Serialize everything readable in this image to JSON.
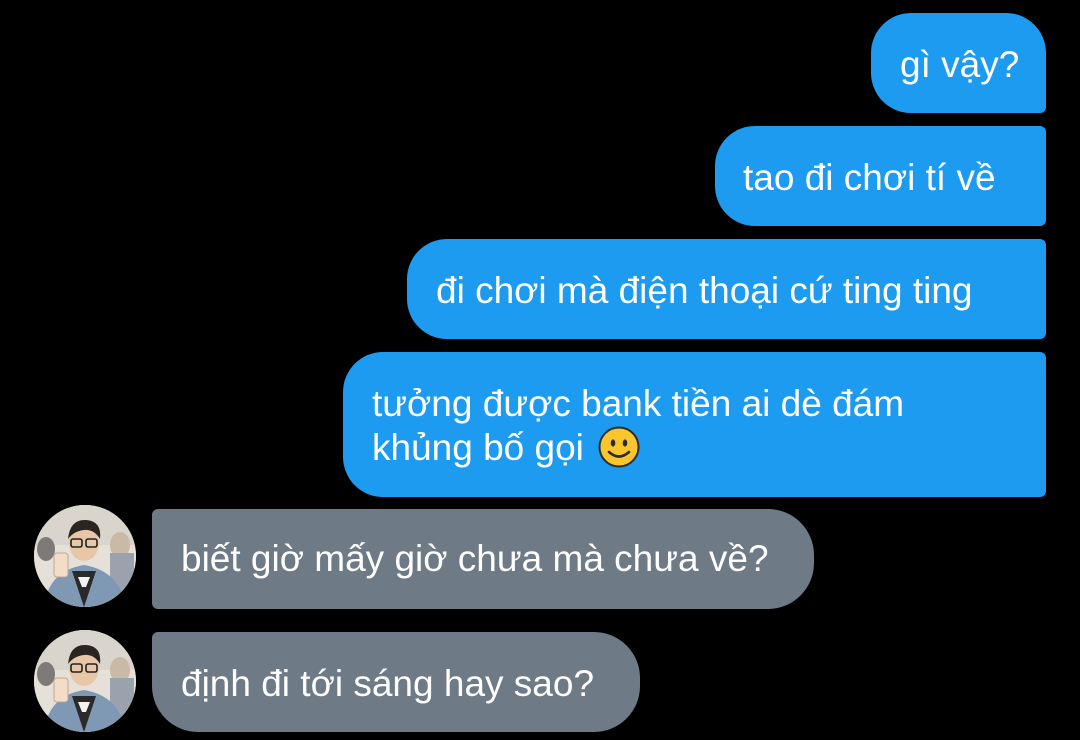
{
  "conversation": {
    "outgoing": [
      {
        "text": "gì vậy?"
      },
      {
        "text": "tao đi chơi tí về"
      },
      {
        "text": "đi chơi mà điện thoại cứ ting ting"
      },
      {
        "line1": "tưởng được bank tiền ai dè đám",
        "line2": "khủng bố gọi",
        "emoji": "smiling-face-icon"
      }
    ],
    "incoming": [
      {
        "text": "biết giờ mấy giờ chưa mà chưa về?"
      },
      {
        "text": "định đi tới sáng hay sao?"
      }
    ]
  },
  "colors": {
    "background": "#000000",
    "outgoing_bubble": "#1d9bf0",
    "incoming_bubble": "#6e7a86",
    "text": "#ffffff"
  }
}
